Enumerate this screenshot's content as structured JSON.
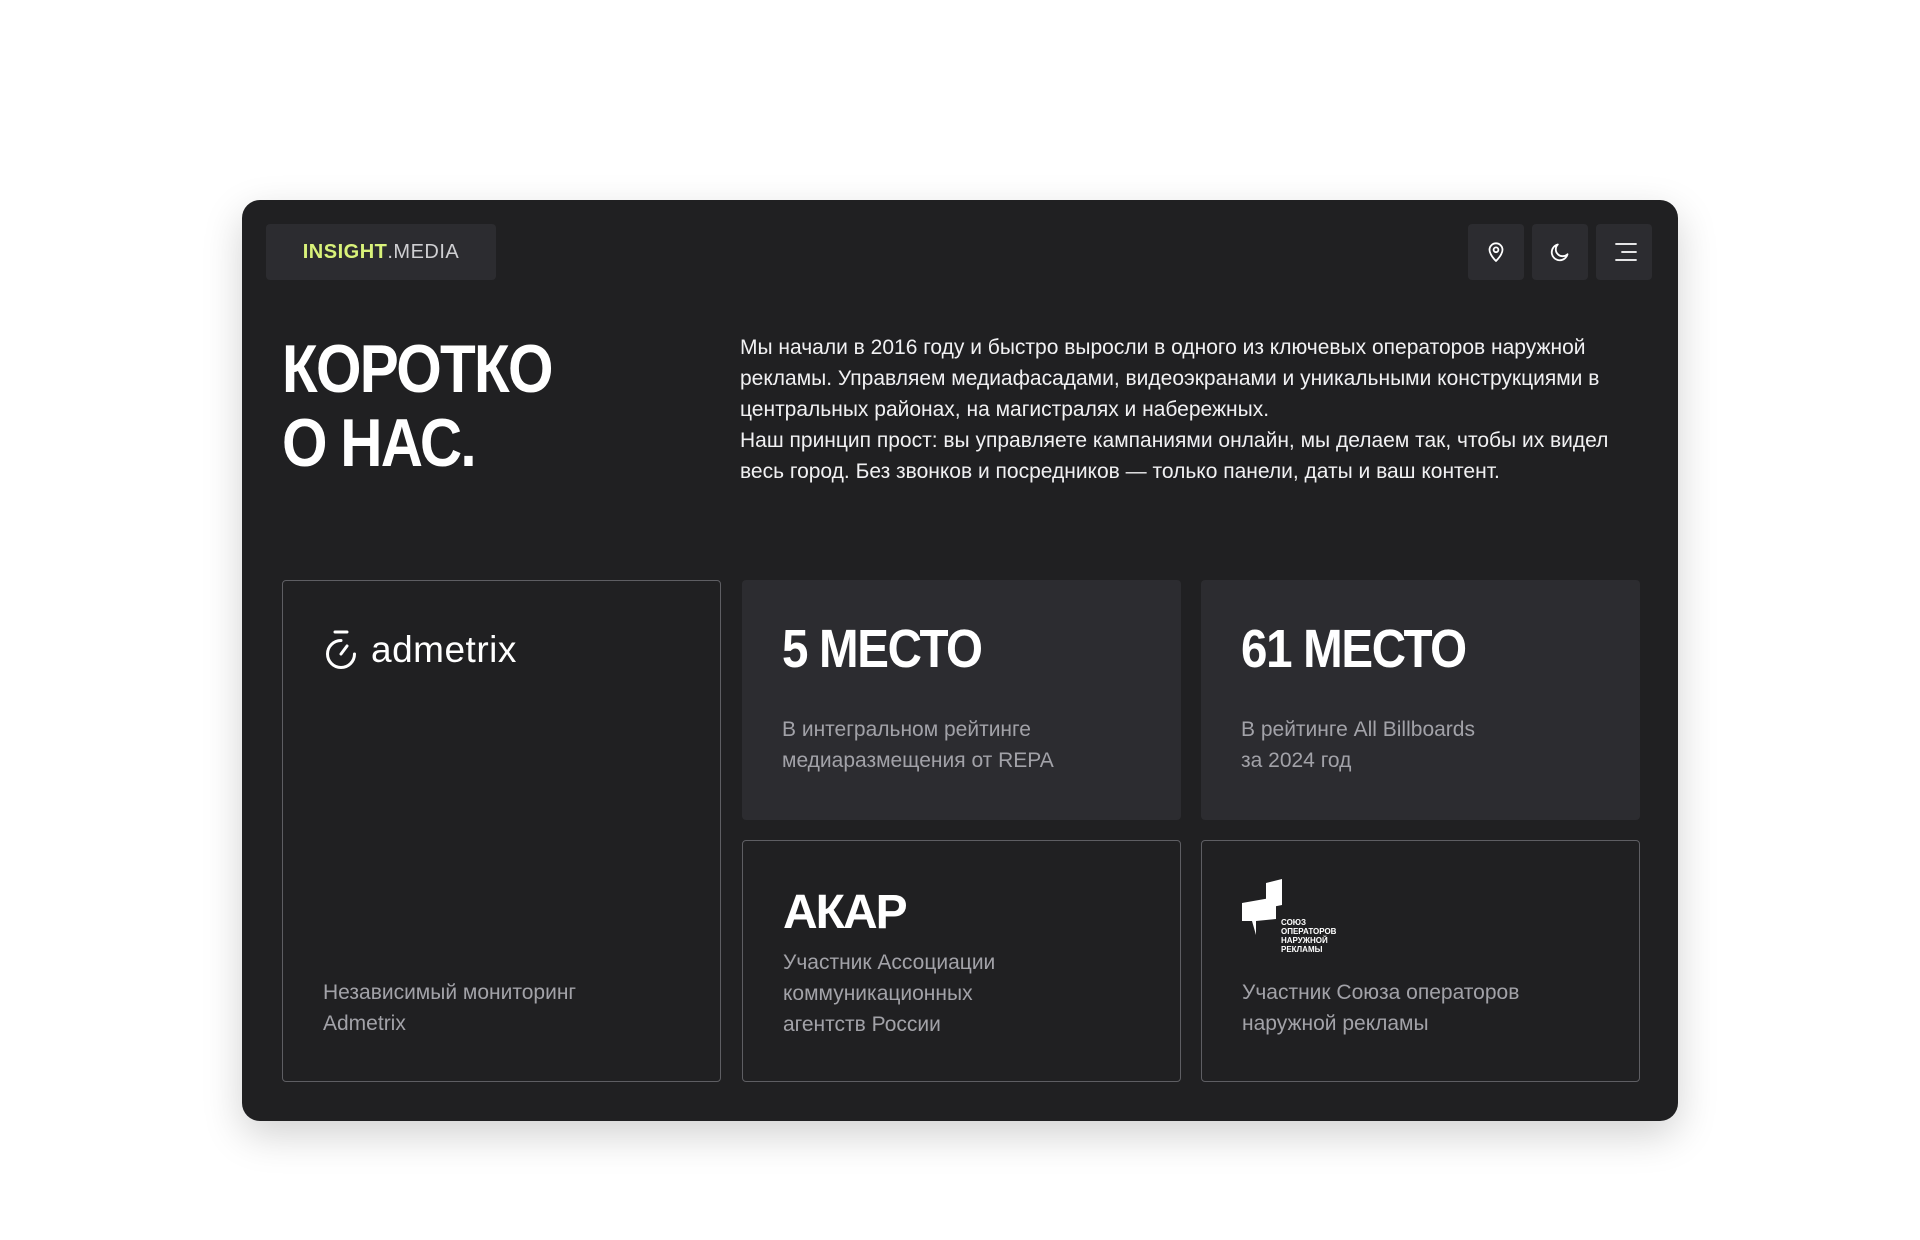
{
  "header": {
    "logo": {
      "accent": "INSIGHT",
      "rest": ".MEDIA"
    },
    "buttons": [
      {
        "icon": "location-pin-icon"
      },
      {
        "icon": "moon-icon"
      },
      {
        "icon": "menu-icon"
      }
    ]
  },
  "about": {
    "title_line1": "КОРОТКО",
    "title_line2": "О НАС.",
    "paragraph1": "Мы начали в 2016 году и быстро выросли в одного из ключевых операторов наружной рекламы. Управляем медиафасадами, видеоэкранами и уникальными конструкциями в центральных районах, на магистралях и набережных.",
    "paragraph2": "Наш принцип прост: вы управляете кампаниями онлайн, мы делаем так, чтобы их видел весь город. Без звонков и посредников — только панели, даты и ваш контент."
  },
  "cards": {
    "admetrix": {
      "logo_text": "admetrix",
      "desc_line1": "Независимый мониторинг",
      "desc_line2": "Admetrix"
    },
    "repa": {
      "big": "5 МЕСТО",
      "desc_line1": "В интегральном рейтинге",
      "desc_line2": "медиаразмещения от REPA"
    },
    "billboards": {
      "big": "61 МЕСТО",
      "desc_line1": "В рейтинге All Billboards",
      "desc_line2": "за 2024 год"
    },
    "akar": {
      "logo_text": "АКАР",
      "desc_line1": "Участник Ассоциации",
      "desc_line2": "коммуникационных",
      "desc_line3": "агентств России"
    },
    "soyuz": {
      "logo_line1": "СОЮЗ",
      "logo_line2": "ОПЕРАТОРОВ",
      "logo_line3": "НАРУЖНОЙ",
      "logo_line4": "РЕКЛАМЫ",
      "desc_line1": "Участник Союза операторов",
      "desc_line2": "наружной рекламы"
    }
  },
  "colors": {
    "background": "#202022",
    "card": "#2c2c30",
    "accent": "#d9f27a",
    "muted_text": "#a2a2a8"
  }
}
